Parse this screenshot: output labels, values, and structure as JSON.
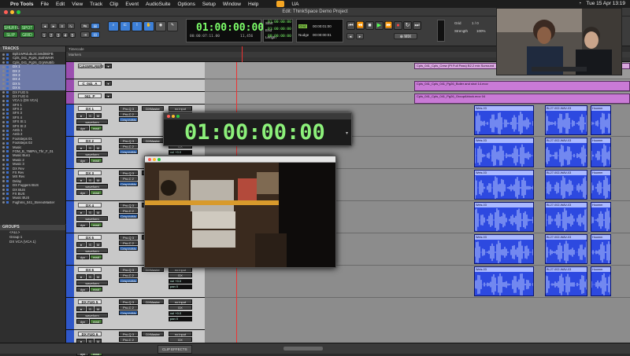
{
  "menubar": {
    "app": "Pro Tools",
    "items": [
      "File",
      "Edit",
      "View",
      "Track",
      "Clip",
      "Event",
      "AudioSuite",
      "Options",
      "Setup",
      "Window",
      "Help"
    ],
    "lang": "UA",
    "clock": "Tue 15 Apr  13:19"
  },
  "window": {
    "title": "Edit: ThinkSpace Demo Project"
  },
  "toolbar": {
    "mode_shuffle": "SHUFFLE",
    "mode_spot": "SPOT",
    "mode_slip": "SLIP",
    "mode_grid": "GRID",
    "main_counter": "01:00:00:00",
    "sub_counter": "00:00:07:11.00",
    "cursor_label": "Cursor",
    "cursor_value": "11,456",
    "start_label": "Start",
    "end_label": "End",
    "length_label": "Length",
    "start_value": "01:00:00:00",
    "end_value": "01:00:00:00",
    "length_value": "00:00:00:00",
    "grid_label": "Grid",
    "nudge_label": "Nudge",
    "grid_value": "00:00:01:00",
    "nudge_value": "00:00:00:01",
    "grid_right_label": "Grid",
    "grid_right_value": "1 / 0",
    "strength_label": "Strength",
    "strength_value": "100%",
    "zoom_value": "5"
  },
  "rulers": {
    "timecode": "Timecode",
    "markers": "Markers"
  },
  "tracks_panel": {
    "title": "TRACKS",
    "items": [
      {
        "label": "Bplt1WRdubLitCin8d0BiFB",
        "selected": false
      },
      {
        "label": "Cpls_041_Pg26_BothWHR",
        "selected": false
      },
      {
        "label": "Cpls_041_Pg26_GrpWuBib",
        "selected": false
      },
      {
        "label": "DX 1",
        "selected": true
      },
      {
        "label": "DX 2",
        "selected": true
      },
      {
        "label": "DX 3",
        "selected": true
      },
      {
        "label": "DX 4",
        "selected": true
      },
      {
        "label": "DX 5",
        "selected": true
      },
      {
        "label": "DX 6",
        "selected": true
      },
      {
        "label": "DX FUG 5",
        "selected": false
      },
      {
        "label": "DX FUG 6",
        "selected": false
      },
      {
        "label": "VCA 1 (DX VCA)",
        "selected": false
      },
      {
        "label": "SFX 1",
        "selected": false
      },
      {
        "label": "SFX 2",
        "selected": false
      },
      {
        "label": "SFX 3",
        "selected": false
      },
      {
        "label": "SFX 4",
        "selected": false
      },
      {
        "label": "SFX St 1",
        "selected": false
      },
      {
        "label": "SFX St 2",
        "selected": false
      },
      {
        "label": "Amb 1",
        "selected": false
      },
      {
        "label": "Amb 2",
        "selected": false
      },
      {
        "label": "Footsteps 01",
        "selected": false
      },
      {
        "label": "Footsteps 02",
        "selected": false
      },
      {
        "label": "Music",
        "selected": false
      },
      {
        "label": "FOM_B_768Pm_Thr_F_01",
        "selected": false
      },
      {
        "label": "Music Bus1",
        "selected": false
      },
      {
        "label": "Music 2",
        "selected": false
      },
      {
        "label": "Music 3",
        "selected": false
      },
      {
        "label": "DX Rev",
        "selected": false
      },
      {
        "label": "FX Rev",
        "selected": false
      },
      {
        "label": "MX Rev",
        "selected": false
      },
      {
        "label": "Delay",
        "selected": false
      },
      {
        "label": "DX Fuggers BUS",
        "selected": false
      },
      {
        "label": "DX BUS",
        "selected": false
      },
      {
        "label": "FX BUS",
        "selected": false
      },
      {
        "label": "Music BUS",
        "selected": false
      },
      {
        "label": "Fughms_041_StereoMaster",
        "selected": false
      }
    ]
  },
  "groups_panel": {
    "title": "GROUPS",
    "items": [
      "<ALL>",
      "Group 1",
      "DX VCA (VCA 1)"
    ]
  },
  "track_headers": [
    {
      "name": "Cpl4WRLREF2",
      "type": "video"
    },
    {
      "name": "C_041_A",
      "type": "audio"
    },
    {
      "name": "041_P",
      "type": "audio"
    },
    {
      "name": "DX 1",
      "type": "dx"
    },
    {
      "name": "DX 2",
      "type": "dx"
    },
    {
      "name": "DX 3",
      "type": "dx"
    },
    {
      "name": "DX 4",
      "type": "dx"
    },
    {
      "name": "DX 5",
      "type": "dx"
    },
    {
      "name": "DX 6",
      "type": "dx"
    },
    {
      "name": "DX FUG 5",
      "type": "dx"
    },
    {
      "name": "DX FUG 6",
      "type": "dx"
    }
  ],
  "track_controls": {
    "view": "waveform",
    "dyn": "dyn",
    "read": "read",
    "plugin1": "Pro-Q 3",
    "plugin2": "Pro-C 2",
    "plugin3": "CrispVdMs",
    "io_in": "no input",
    "io_out": "DX",
    "bus": "DXMaster",
    "vol_label": "vol",
    "vol_value": "+0.0",
    "pan_label": "pan",
    "pan_value": "0"
  },
  "edit_area": {
    "top_clip": "Cpls_041_Cpls_Crew (Pt Full Pass) B2.2 mix Surround",
    "pink1": "Cpls_041_Cpls_041_Pg26_Boiler and shot 14.mov",
    "pink2": "Cpls_041_Cpls_041_Pg26_GroupAblock.mov 04",
    "blue_labels": [
      "Weis-03",
      "Hoomme-03",
      "BL27-002-WAV-03",
      "Hoomm",
      "W"
    ]
  },
  "bigcounter": {
    "value": "01:00:00:00"
  },
  "bottombar": {
    "tabs": [
      "CLIP EFFECTS"
    ]
  },
  "colors": {
    "counter_green": "#8cf07a",
    "clip_blue": "#2d49e0",
    "clip_pink": "#c97ad6",
    "track_blue": "#2f57c9",
    "selection": "#6e7aa8"
  }
}
